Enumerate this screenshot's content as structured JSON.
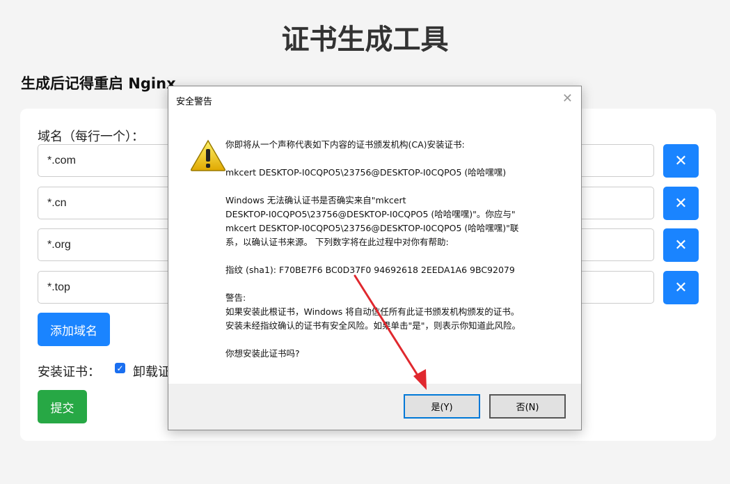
{
  "page": {
    "title": "证书生成工具",
    "subtitle": "生成后记得重启 Nginx"
  },
  "form": {
    "domain_label": "域名（每行一个）：",
    "domains": [
      "*.com",
      "*.cn",
      "*.org",
      "*.top"
    ],
    "remove_label": "✕",
    "add_button": "添加域名",
    "install_label": "安装证书：",
    "uninstall_label": "卸载证",
    "uninstall_checked": true,
    "submit_button": "提交"
  },
  "dialog": {
    "title": "安全警告",
    "close_glyph": "✕",
    "icon": "warning-icon",
    "lines": [
      "你即将从一个声称代表如下内容的证书颁发机构(CA)安装证书:",
      "",
      "mkcert DESKTOP-I0CQPO5\\23756@DESKTOP-I0CQPO5 (哈哈嘿嘿)",
      "",
      "Windows 无法确认证书是否确实来自\"mkcert",
      "DESKTOP-I0CQPO5\\23756@DESKTOP-I0CQPO5 (哈哈嘿嘿)\"。你应与\"",
      "mkcert DESKTOP-I0CQPO5\\23756@DESKTOP-I0CQPO5 (哈哈嘿嘿)\"联",
      "系，以确认证书来源。 下列数字将在此过程中对你有帮助:",
      "",
      "指纹 (sha1): F70BE7F6 BC0D37F0 94692618 2EEDA1A6 9BC92079",
      "",
      "警告:",
      "如果安装此根证书，Windows 将自动信任所有此证书颁发机构颁发的证书。",
      "安装未经指纹确认的证书有安全风险。如果单击\"是\"，则表示你知道此风险。",
      "",
      "你想安装此证书吗?"
    ],
    "yes_button": "是(Y)",
    "no_button": "否(N)"
  },
  "colors": {
    "primary": "#1a84ff",
    "success": "#27a845",
    "arrow": "#e0282e",
    "dialog_focus": "#0078d7"
  }
}
